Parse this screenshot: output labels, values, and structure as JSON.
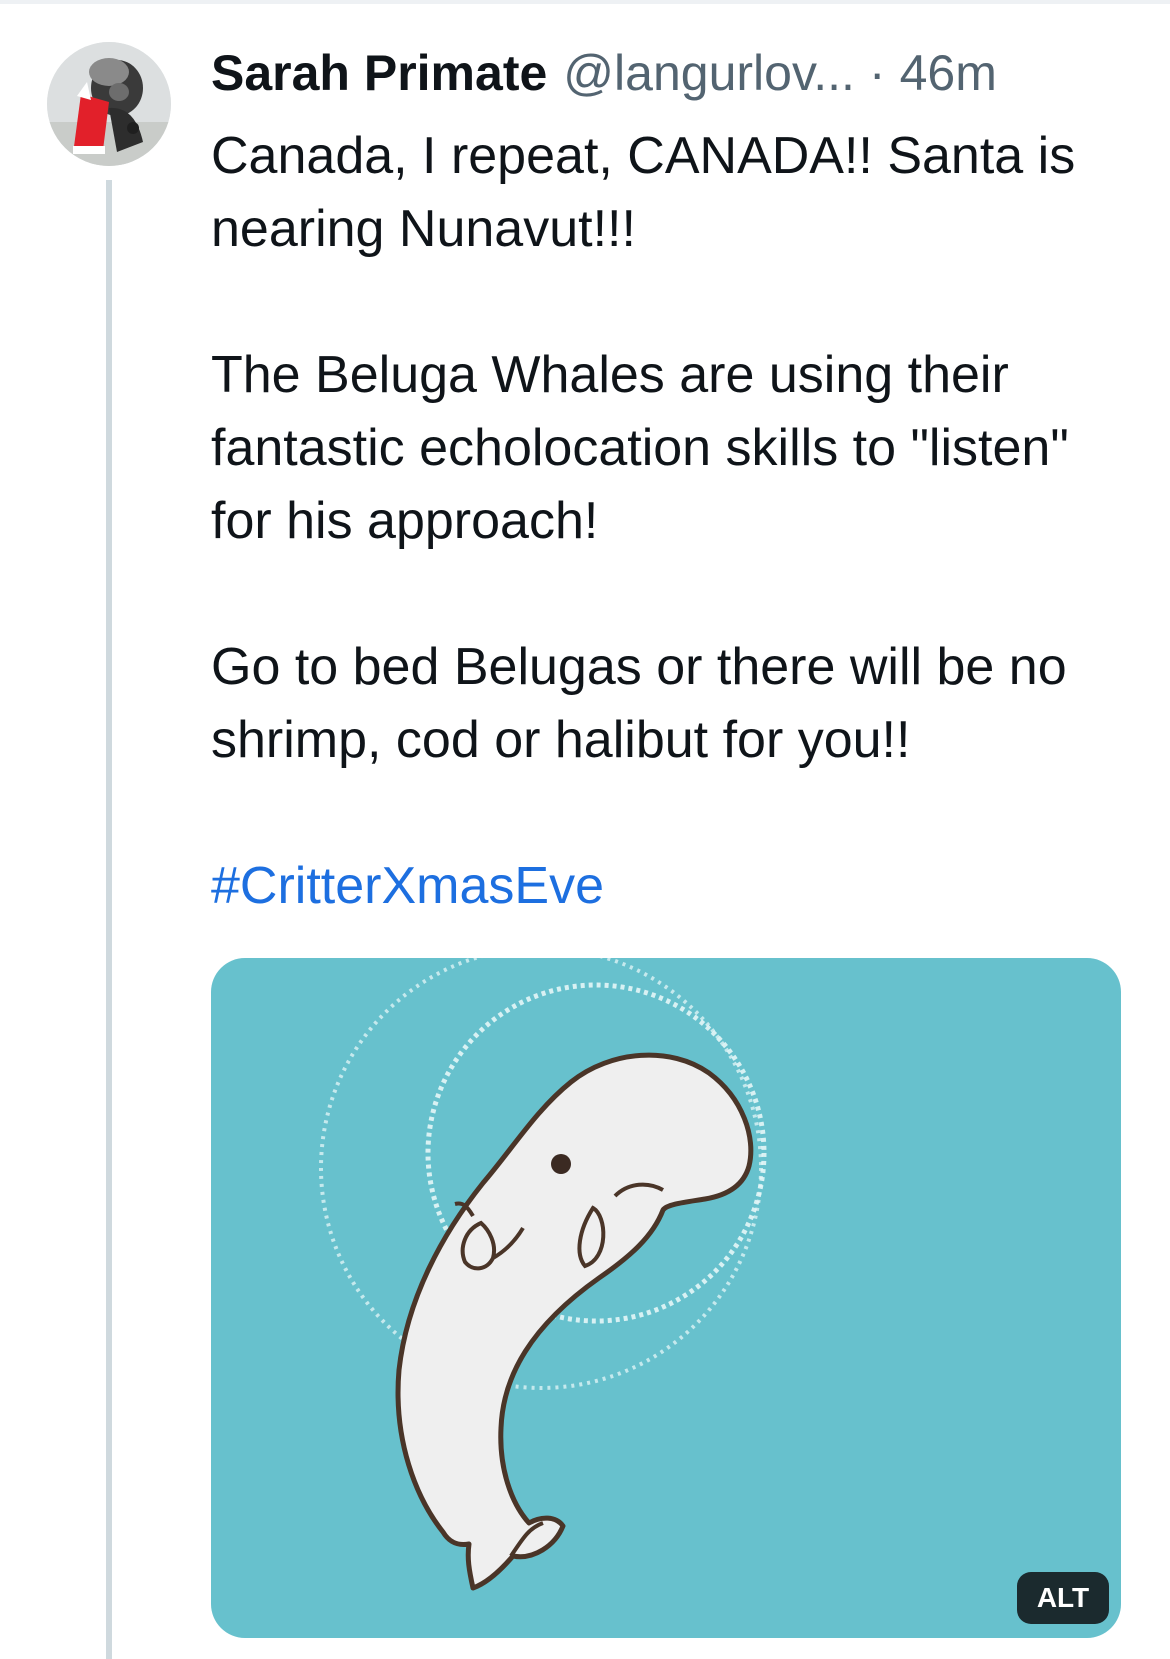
{
  "post": {
    "display_name": "Sarah Primate",
    "handle": "@langurlov...",
    "separator": "·",
    "timestamp": "46m",
    "paragraphs": [
      "Canada, I repeat, CANADA!! Santa is nearing Nunavut!!!",
      "The Beluga Whales are using their fantastic echolocation skills to \"listen\" for his approach!",
      "Go to bed Belugas or there will be no shrimp, cod or halibut for you!!"
    ],
    "hashtag": "#CritterXmasEve",
    "media": {
      "alt_label": "ALT",
      "background_color": "#67c1cd"
    }
  },
  "colors": {
    "link": "#1d6fe0",
    "muted": "#536471",
    "thread_line": "#cfd9de"
  }
}
